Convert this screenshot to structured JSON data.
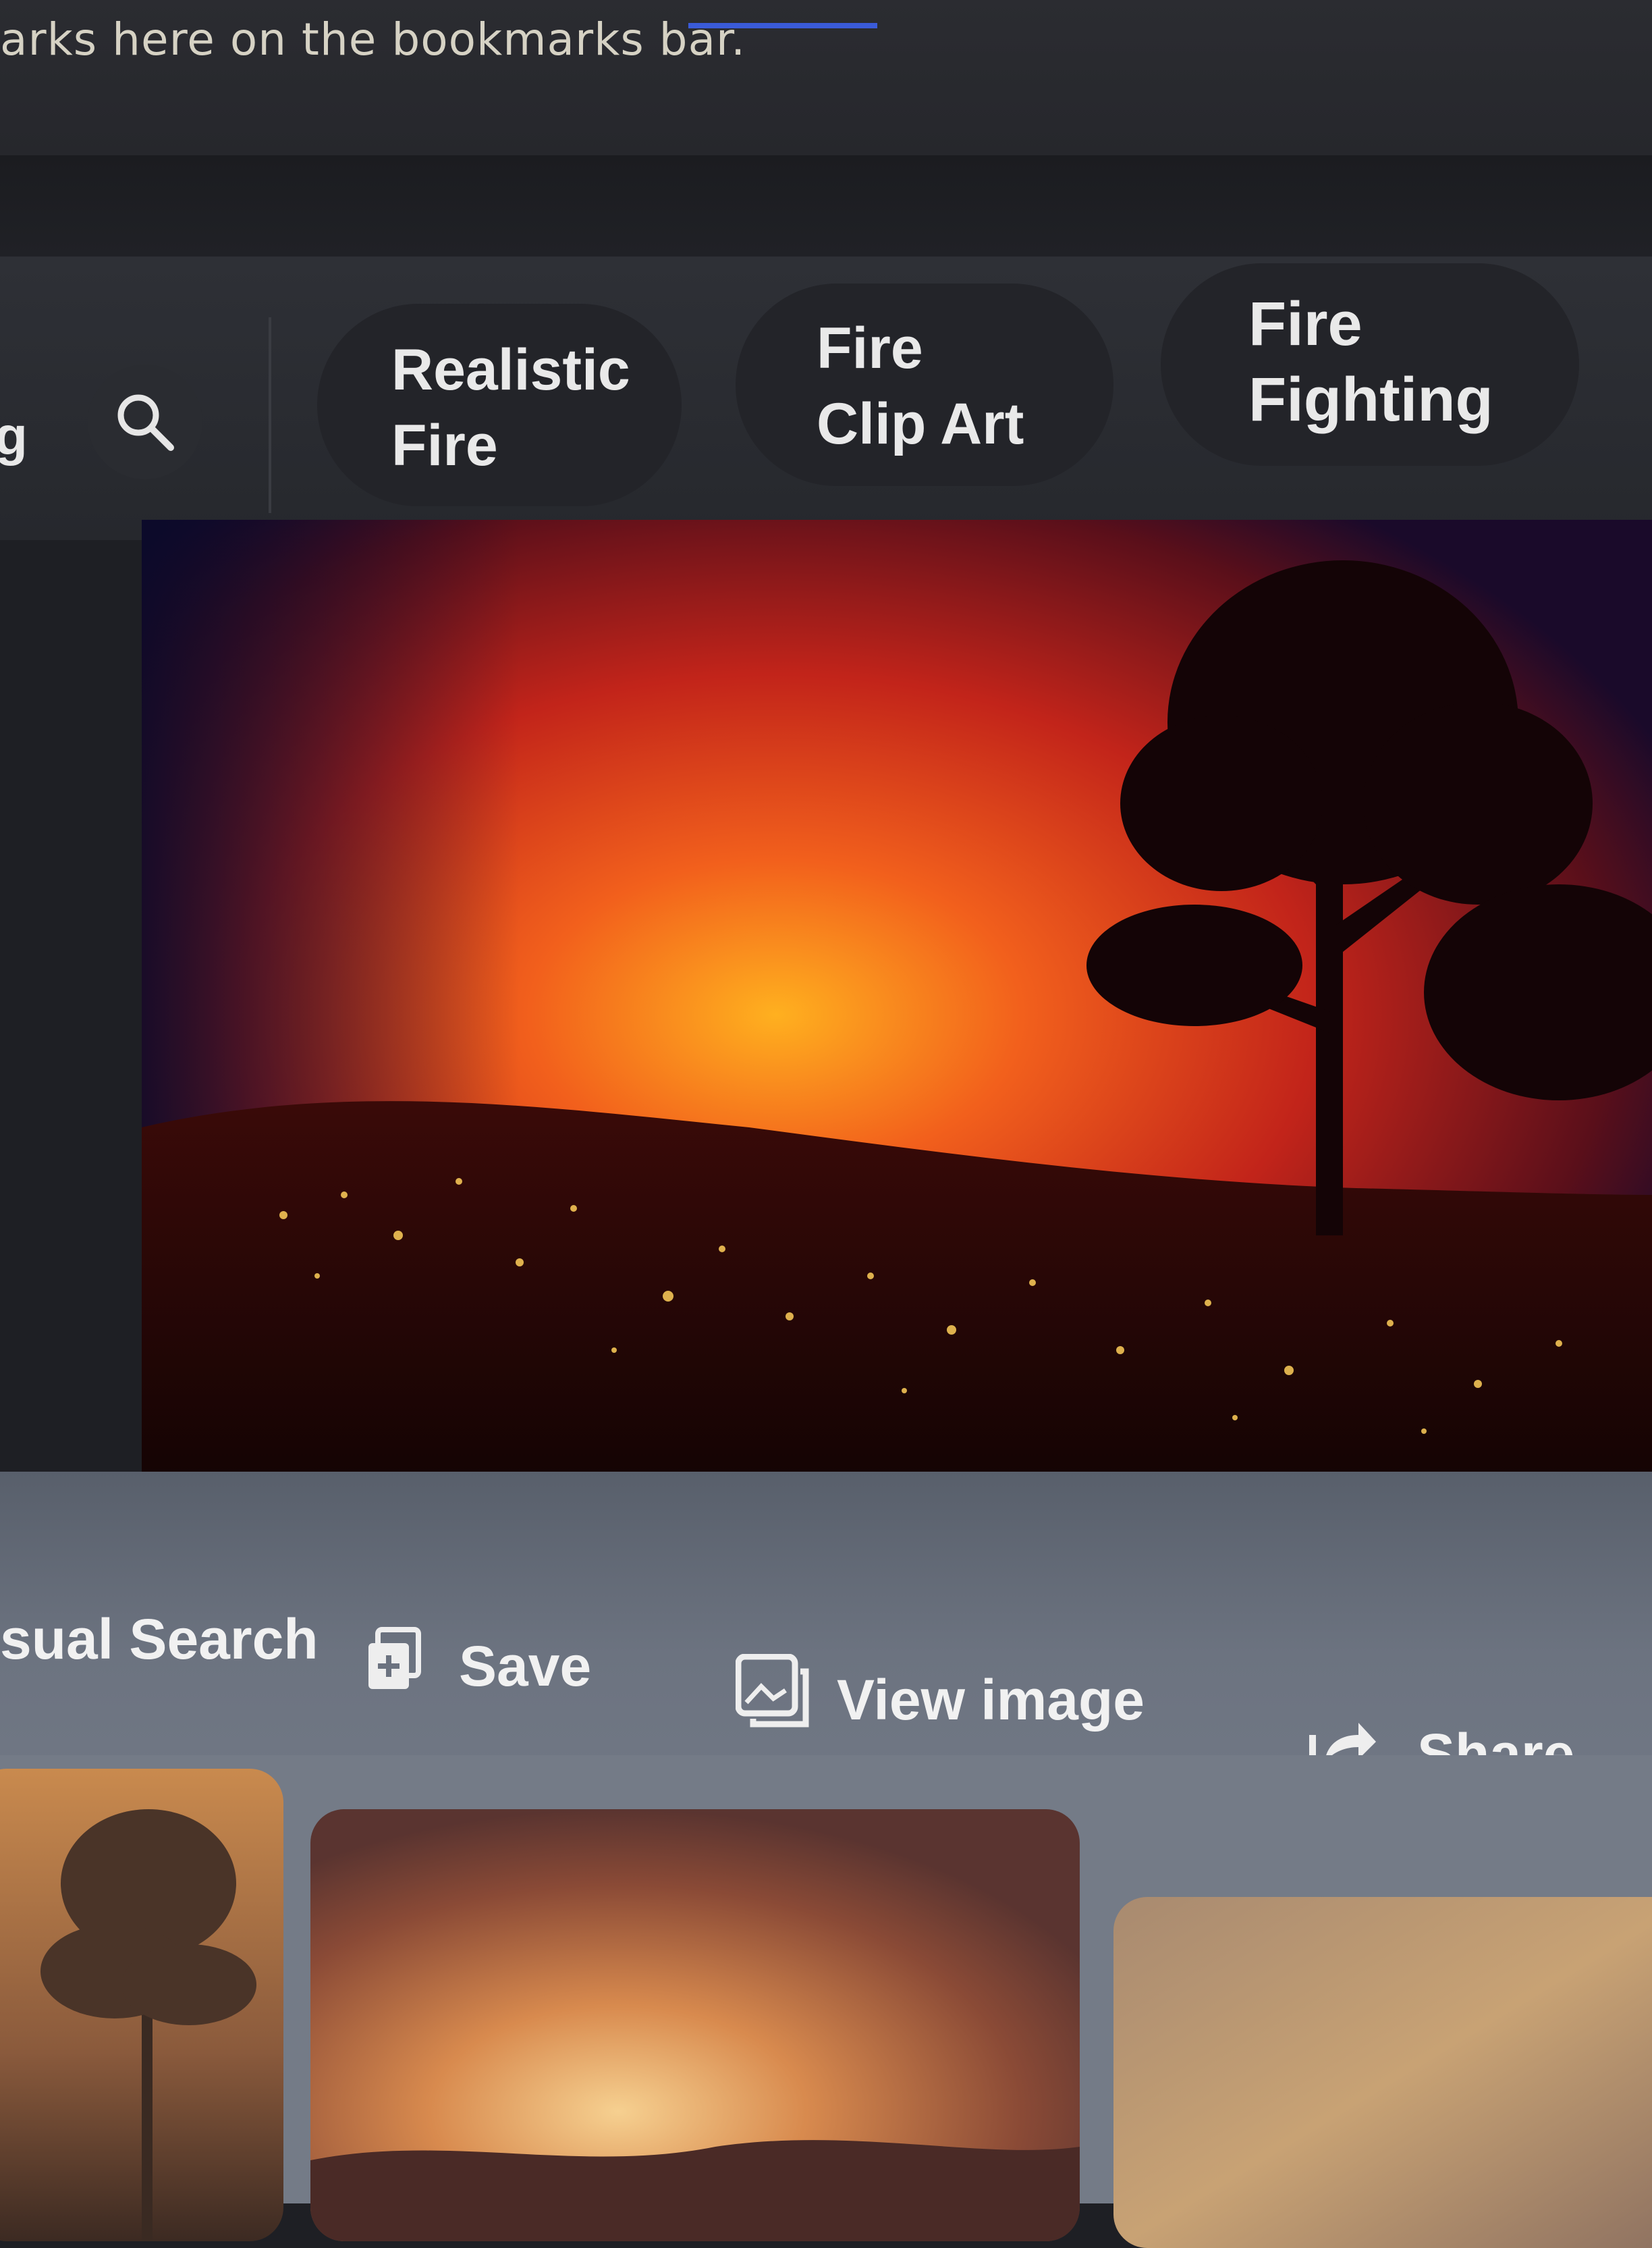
{
  "bookmarks_bar": {
    "text": "arks here on the bookmarks bar."
  },
  "search": {
    "cut_text": "g"
  },
  "related_chips": [
    {
      "line1": "Realistic",
      "line2": "Fire"
    },
    {
      "line1": "Fire",
      "line2": "Clip Art"
    },
    {
      "line1": "Fire",
      "line2": "Fighting"
    }
  ],
  "actions": {
    "visual_search": "sual Search",
    "save": "Save",
    "view_image": "View image",
    "share": "Share"
  },
  "colors": {
    "accent_link": "#3a5bd8",
    "chip_bg": "#232429",
    "toolbar_bg": "#6c7380"
  },
  "icons": [
    "search-icon",
    "save-icon",
    "view-image-icon",
    "share-icon"
  ]
}
